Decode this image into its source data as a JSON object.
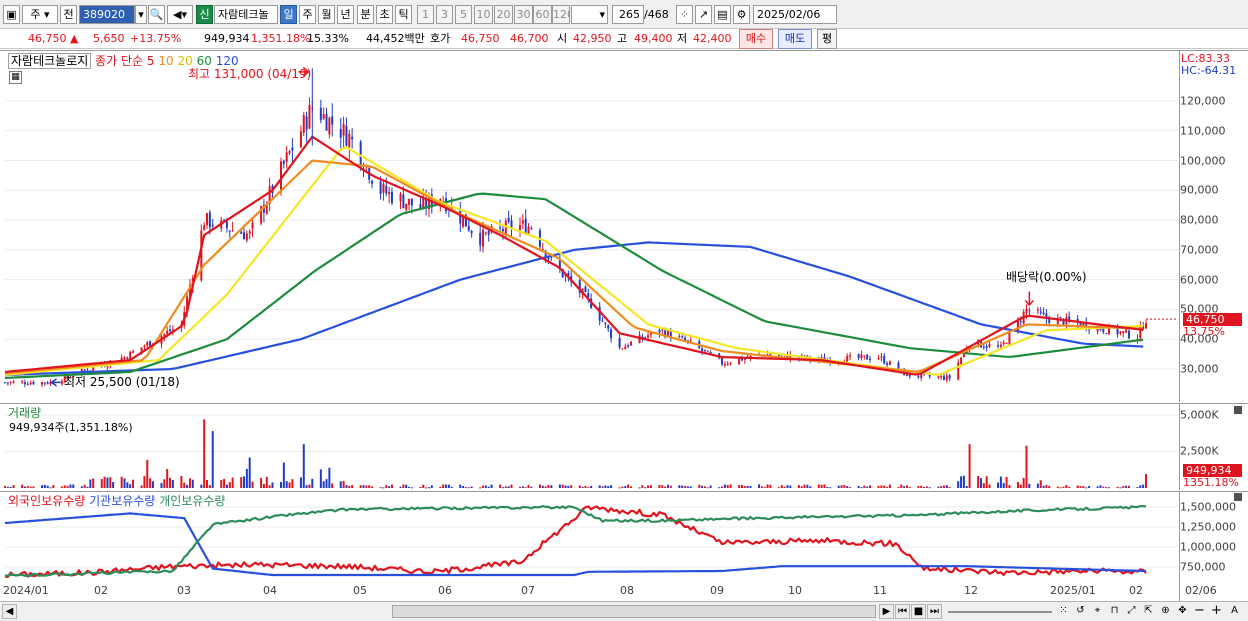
{
  "toolbar": {
    "period_main": "주",
    "period_prev": "전",
    "stock_code": "389020",
    "new_badge": "신",
    "stock_name": "자람테크놀",
    "periods": [
      "일",
      "주",
      "월",
      "년",
      "분",
      "초",
      "틱"
    ],
    "intervals": [
      "1",
      "3",
      "5",
      "10",
      "20",
      "30",
      "60",
      "120"
    ],
    "count": "265",
    "count_total": "/468",
    "date": "2025/02/06"
  },
  "quote": {
    "price": "46,750 ▲",
    "change": "5,650",
    "change_pct": "+13.75%",
    "volume": "949,934",
    "volume_pct": "1,351.18%",
    "turnover": "15.33%",
    "amount": "44,452백만",
    "ask_label": "호가",
    "ask": "46,750",
    "bid": "46,700",
    "open_label": "시",
    "open": "42,950",
    "high_label": "고",
    "high": "49,400",
    "low_label": "저",
    "low": "42,400",
    "buy_label": "매수",
    "sell_label": "매도",
    "eval_label": "평"
  },
  "price_panel": {
    "name": "자람테크놀로지",
    "ma_label": "종가 단순",
    "ma_periods": [
      "5",
      "10",
      "20",
      "60",
      "120"
    ],
    "max_label": "최고 131,000 (04/19)",
    "min_label": "최저 25,500 (01/18)",
    "dividend_label": "배당락(0.00%)",
    "lc_label": "LC:83.33",
    "hc_label": "HC:-64.31",
    "last_price_tag": "46,750",
    "last_pct_tag": "13.75%",
    "yticks": [
      "120,000",
      "110,000",
      "100,000",
      "90,000",
      "80,000",
      "70,000",
      "60,000",
      "50,000",
      "40,000",
      "30,000"
    ]
  },
  "volume_panel": {
    "name": "거래량",
    "sub": "949,934주(1,351.18%)",
    "yticks": [
      "5,000K",
      "2,500K"
    ],
    "last_value": "949,934",
    "last_pct": "1351.18%"
  },
  "holder_panel": {
    "legend": [
      "외국인보유수량",
      "기관보유수량",
      "개인보유수량"
    ],
    "yticks": [
      "1,500,000",
      "1,250,000",
      "1,000,000",
      "750,000"
    ]
  },
  "xaxis": {
    "labels": [
      "2024/01",
      "02",
      "03",
      "04",
      "05",
      "06",
      "07",
      "08",
      "09",
      "10",
      "11",
      "12",
      "2025/01",
      "02",
      "02/06"
    ]
  },
  "colors": {
    "up": "#e0141e",
    "down": "#1e3cc8",
    "ma5": "#e0141e",
    "ma10": "#f08c1e",
    "ma20": "#f5e628",
    "ma60": "#1e8c3c",
    "ma120": "#2850dc",
    "foreign": "#e0141e",
    "institution": "#2850dc",
    "individual": "#2e8c5a"
  },
  "chart_data": [
    {
      "type": "candlestick",
      "title": "자람테크놀로지",
      "ylim": [
        23000,
        133000
      ],
      "x_range": [
        "2024/01/02",
        "2025/02/06"
      ],
      "ohlc_anchors": [
        {
          "date": "2024/01/18",
          "value": 25500
        },
        {
          "date": "2024/02/13",
          "value": 34000
        },
        {
          "date": "2024/03/04",
          "value": 45000
        },
        {
          "date": "2024/03/12",
          "value": 80000
        },
        {
          "date": "2024/03/28",
          "value": 75000
        },
        {
          "date": "2024/04/19",
          "value": 118000
        },
        {
          "date": "2024/05/02",
          "value": 108000
        },
        {
          "date": "2024/05/13",
          "value": 90000
        },
        {
          "date": "2024/05/27",
          "value": 84000
        },
        {
          "date": "2024/06/03",
          "value": 88000
        },
        {
          "date": "2024/06/17",
          "value": 74000
        },
        {
          "date": "2024/06/28",
          "value": 78000
        },
        {
          "date": "2024/07/05",
          "value": 78000
        },
        {
          "date": "2024/07/12",
          "value": 66000
        },
        {
          "date": "2024/07/26",
          "value": 52000
        },
        {
          "date": "2024/08/05",
          "value": 37000
        },
        {
          "date": "2024/08/19",
          "value": 43000
        },
        {
          "date": "2024/08/29",
          "value": 39000
        },
        {
          "date": "2024/09/10",
          "value": 32000
        },
        {
          "date": "2024/09/25",
          "value": 35000
        },
        {
          "date": "2024/10/16",
          "value": 33000
        },
        {
          "date": "2024/11/04",
          "value": 34000
        },
        {
          "date": "2024/11/14",
          "value": 28000
        },
        {
          "date": "2024/11/29",
          "value": 27000
        },
        {
          "date": "2024/12/06",
          "value": 39000
        },
        {
          "date": "2024/12/17",
          "value": 37000
        },
        {
          "date": "2024/12/26",
          "value": 50000
        },
        {
          "date": "2025/01/02",
          "value": 47000
        },
        {
          "date": "2025/01/15",
          "value": 45000
        },
        {
          "date": "2025/02/03",
          "value": 41000
        },
        {
          "date": "2025/02/06",
          "value": 46750
        }
      ],
      "max": {
        "date": "2024/04/19",
        "value": 131000
      },
      "min": {
        "date": "2024/01/18",
        "value": 25500
      }
    },
    {
      "type": "line",
      "title": "",
      "series": [
        {
          "name": "5",
          "points": [
            [
              "2024/01/02",
              29000
            ],
            [
              "2024/02/15",
              33000
            ],
            [
              "2024/03/05",
              45000
            ],
            [
              "2024/03/12",
              75000
            ],
            [
              "2024/04/05",
              90000
            ],
            [
              "2024/04/19",
              108000
            ],
            [
              "2024/05/10",
              95000
            ],
            [
              "2024/06/03",
              85000
            ],
            [
              "2024/06/24",
              75000
            ],
            [
              "2024/07/15",
              64000
            ],
            [
              "2024/08/05",
              42000
            ],
            [
              "2024/09/10",
              34000
            ],
            [
              "2024/10/15",
              33000
            ],
            [
              "2024/11/18",
              28000
            ],
            [
              "2024/12/26",
              48000
            ],
            [
              "2025/02/06",
              43000
            ]
          ]
        },
        {
          "name": "10",
          "points": [
            [
              "2024/01/02",
              28500
            ],
            [
              "2024/02/20",
              33000
            ],
            [
              "2024/03/12",
              65000
            ],
            [
              "2024/04/19",
              100000
            ],
            [
              "2024/05/10",
              98000
            ],
            [
              "2024/06/10",
              82000
            ],
            [
              "2024/07/15",
              67000
            ],
            [
              "2024/08/10",
              44000
            ],
            [
              "2024/09/10",
              36000
            ],
            [
              "2024/11/18",
              29000
            ],
            [
              "2024/12/26",
              45000
            ],
            [
              "2025/02/06",
              43500
            ]
          ]
        },
        {
          "name": "20",
          "points": [
            [
              "2024/01/02",
              28000
            ],
            [
              "2024/02/25",
              33000
            ],
            [
              "2024/03/20",
              55000
            ],
            [
              "2024/04/30",
              105000
            ],
            [
              "2024/06/03",
              86000
            ],
            [
              "2024/07/10",
              73000
            ],
            [
              "2024/08/15",
              45000
            ],
            [
              "2024/09/15",
              37000
            ],
            [
              "2024/11/25",
              28000
            ],
            [
              "2025/01/02",
              43000
            ],
            [
              "2025/02/06",
              44500
            ]
          ]
        },
        {
          "name": "60",
          "points": [
            [
              "2024/01/02",
              27000
            ],
            [
              "2024/02/15",
              29000
            ],
            [
              "2024/03/20",
              40000
            ],
            [
              "2024/04/20",
              63000
            ],
            [
              "2024/05/20",
              82000
            ],
            [
              "2024/06/17",
              89000
            ],
            [
              "2024/07/10",
              87000
            ],
            [
              "2024/08/20",
              63000
            ],
            [
              "2024/09/25",
              46000
            ],
            [
              "2024/11/15",
              37000
            ],
            [
              "2024/12/20",
              34000
            ],
            [
              "2025/02/06",
              40000
            ]
          ]
        },
        {
          "name": "120",
          "points": [
            [
              "2024/01/02",
              28000
            ],
            [
              "2024/03/01",
              30000
            ],
            [
              "2024/04/15",
              40000
            ],
            [
              "2024/06/10",
              60000
            ],
            [
              "2024/07/20",
              70000
            ],
            [
              "2024/08/15",
              72500
            ],
            [
              "2024/09/20",
              71000
            ],
            [
              "2024/10/25",
              61000
            ],
            [
              "2024/12/10",
              45000
            ],
            [
              "2025/01/15",
              38500
            ],
            [
              "2025/02/06",
              37500
            ]
          ]
        }
      ]
    },
    {
      "type": "bar",
      "title": "거래량",
      "ylim": [
        0,
        6000000
      ],
      "x_range": [
        "2024/01/02",
        "2025/02/06"
      ],
      "highlights": [
        {
          "date": "2024/03/12",
          "value": 4700000
        },
        {
          "date": "2024/03/15",
          "value": 3900000
        },
        {
          "date": "2024/04/16",
          "value": 3000000
        },
        {
          "date": "2024/02/28",
          "value": 1300000
        },
        {
          "date": "2024/12/06",
          "value": 3000000
        },
        {
          "date": "2024/12/26",
          "value": 2900000
        },
        {
          "date": "2025/02/06",
          "value": 949934
        }
      ]
    },
    {
      "type": "line",
      "title": "",
      "ylim": [
        550000,
        1650000
      ],
      "series": [
        {
          "name": "외국인보유수량",
          "points": [
            [
              "2024/01/02",
              650000
            ],
            [
              "2024/02/01",
              680000
            ],
            [
              "2024/03/01",
              760000
            ],
            [
              "2024/04/01",
              780000
            ],
            [
              "2024/05/01",
              760000
            ],
            [
              "2024/06/01",
              690000
            ],
            [
              "2024/07/01",
              810000
            ],
            [
              "2024/07/25",
              1500000
            ],
            [
              "2024/08/20",
              1400000
            ],
            [
              "2024/09/10",
              1050000
            ],
            [
              "2024/10/15",
              1080000
            ],
            [
              "2024/11/10",
              1040000
            ],
            [
              "2024/11/20",
              730000
            ],
            [
              "2024/12/20",
              680000
            ],
            [
              "2025/01/15",
              700000
            ],
            [
              "2025/02/06",
              690000
            ]
          ]
        },
        {
          "name": "기관보유수량",
          "points": [
            [
              "2024/01/02",
              1300000
            ],
            [
              "2024/02/15",
              1420000
            ],
            [
              "2024/03/05",
              1360000
            ],
            [
              "2024/03/15",
              730000
            ],
            [
              "2024/04/05",
              650000
            ],
            [
              "2024/07/20",
              650000
            ],
            [
              "2024/07/25",
              690000
            ],
            [
              "2024/09/10",
              700000
            ],
            [
              "2024/10/01",
              760000
            ],
            [
              "2024/12/05",
              760000
            ],
            [
              "2025/01/05",
              730000
            ],
            [
              "2025/02/06",
              700000
            ]
          ]
        },
        {
          "name": "개인보유수량",
          "points": [
            [
              "2024/01/02",
              640000
            ],
            [
              "2024/03/01",
              700000
            ],
            [
              "2024/03/15",
              1280000
            ],
            [
              "2024/04/10",
              1400000
            ],
            [
              "2024/05/01",
              1470000
            ],
            [
              "2024/07/20",
              1500000
            ],
            [
              "2024/07/30",
              1330000
            ],
            [
              "2024/08/20",
              1330000
            ],
            [
              "2024/09/20",
              1360000
            ],
            [
              "2024/11/20",
              1400000
            ],
            [
              "2024/12/20",
              1450000
            ],
            [
              "2025/02/06",
              1500000
            ]
          ]
        }
      ]
    }
  ]
}
